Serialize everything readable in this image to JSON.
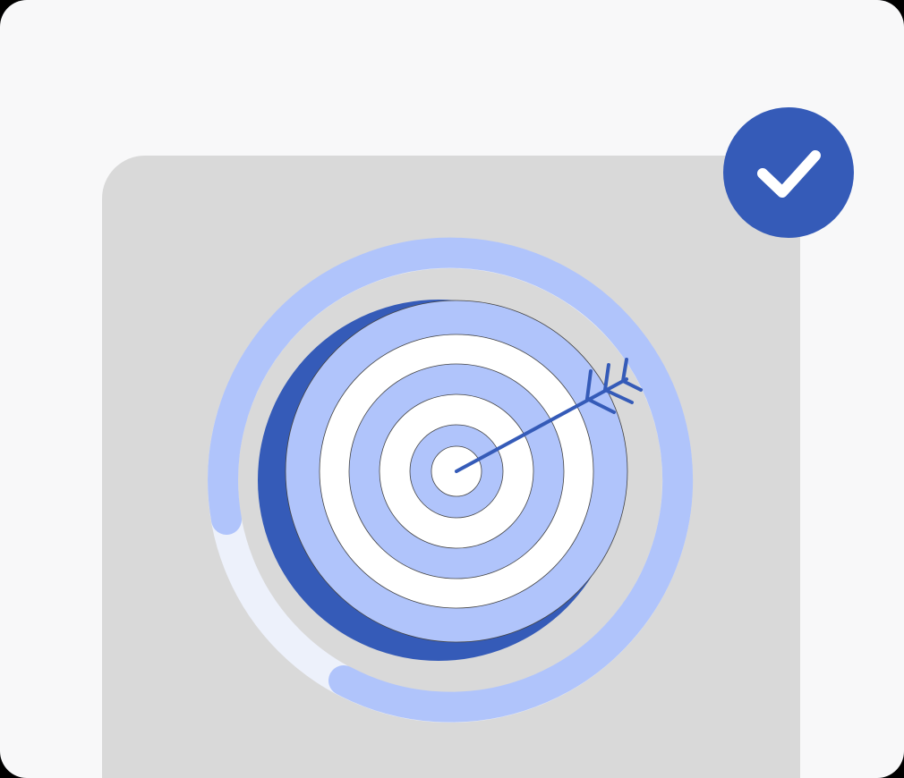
{
  "illustration": {
    "subject": "target-with-arrow",
    "progress_ring_fraction": 0.85,
    "target_rings": 6,
    "status": "success"
  },
  "icons": {
    "target": "bullseye-target-icon",
    "arrow": "arrow-icon",
    "badge": "checkmark-icon"
  },
  "colors": {
    "outer_background": "#f8f8f9",
    "panel_background": "#d9d9d9",
    "accent_dark": "#355bb8",
    "accent_light": "#b0c4fb",
    "track": "#edf1fb",
    "white": "#ffffff"
  }
}
